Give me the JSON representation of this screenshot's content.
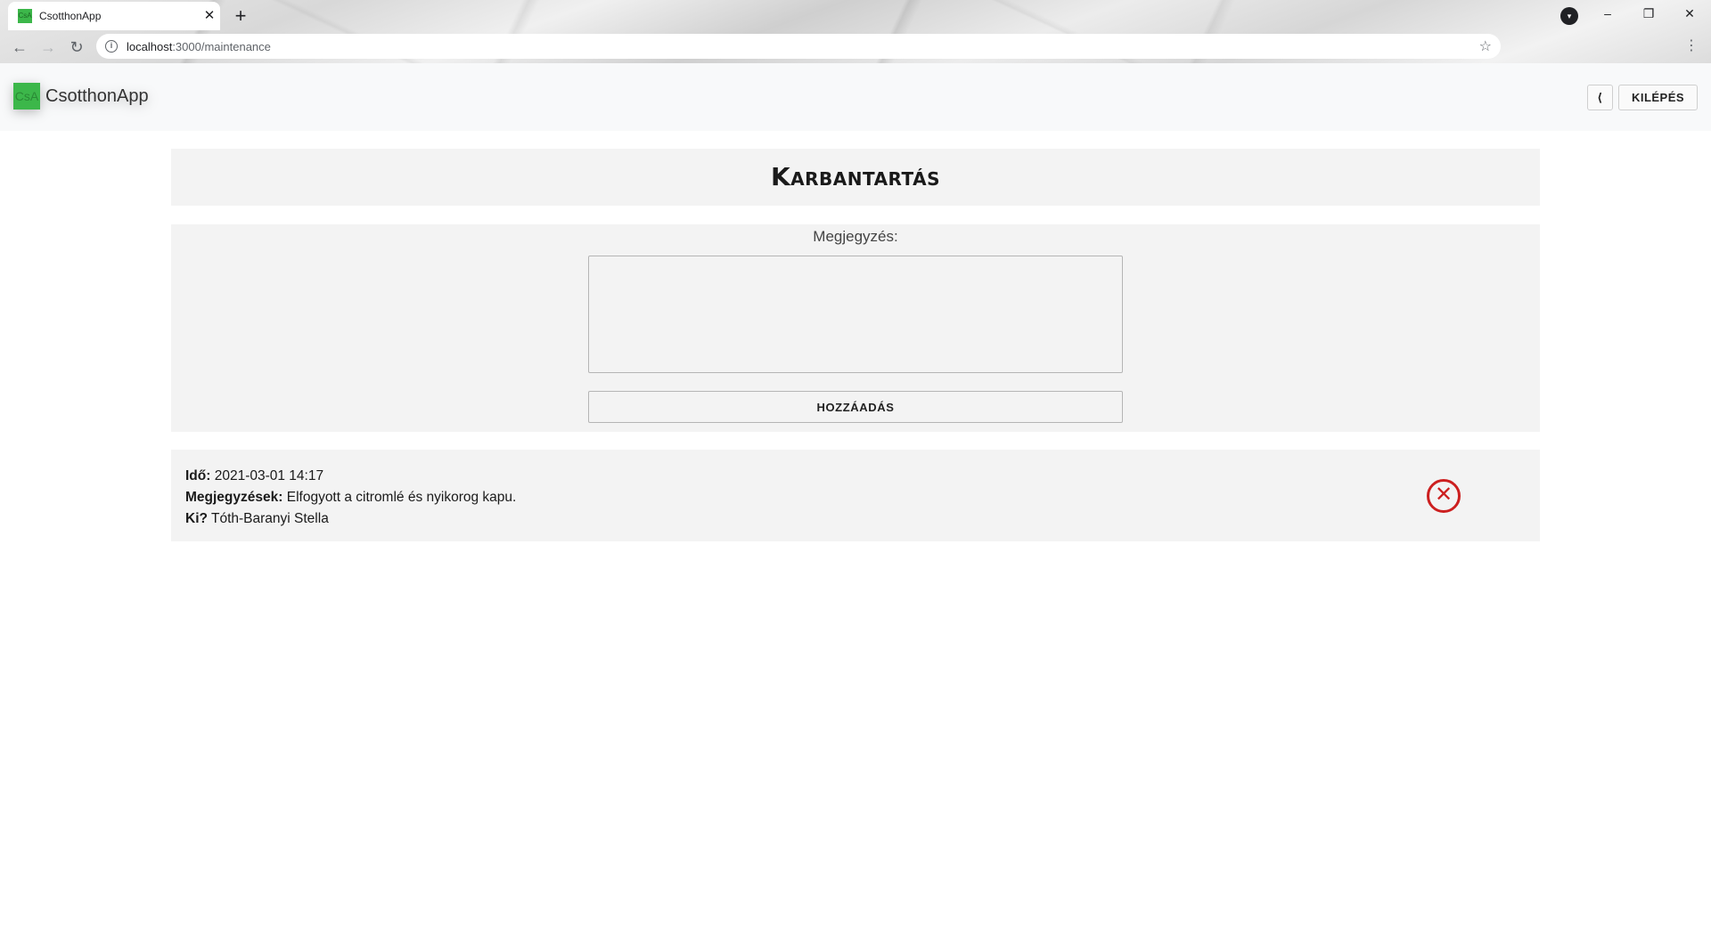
{
  "browser": {
    "tab_title": "CsotthonApp",
    "tab_favicon_text": "CsA",
    "url_host": "localhost",
    "url_path": ":3000/maintenance",
    "icons": {
      "close": "close-icon",
      "new_tab": "plus-icon",
      "back": "back-arrow-icon",
      "forward": "forward-arrow-icon",
      "reload": "reload-icon",
      "info": "info-icon",
      "star": "star-icon",
      "menu": "kebab-menu-icon",
      "profile": "profile-icon"
    }
  },
  "header": {
    "logo_text": "CsA",
    "app_name": "CsotthonApp",
    "back_label": "⟨",
    "logout_label": "KILÉPÉS",
    "accent_color": "#3cb74a"
  },
  "page": {
    "title": "Karbantartás"
  },
  "form": {
    "note_label": "Megjegyzés:",
    "note_value": "",
    "add_label": "HOZZÁADÁS"
  },
  "entries": [
    {
      "time_label": "Idő:",
      "time_value": "2021-03-01 14:17",
      "notes_label": "Megjegyzések:",
      "notes_value": "Elfogyott a citromlé és nyikorog kapu.",
      "who_label": "Ki?",
      "who_value": "Tóth-Baranyi Stella",
      "delete_icon": "delete-circle-x-icon",
      "delete_color": "#cc1f1f"
    }
  ]
}
